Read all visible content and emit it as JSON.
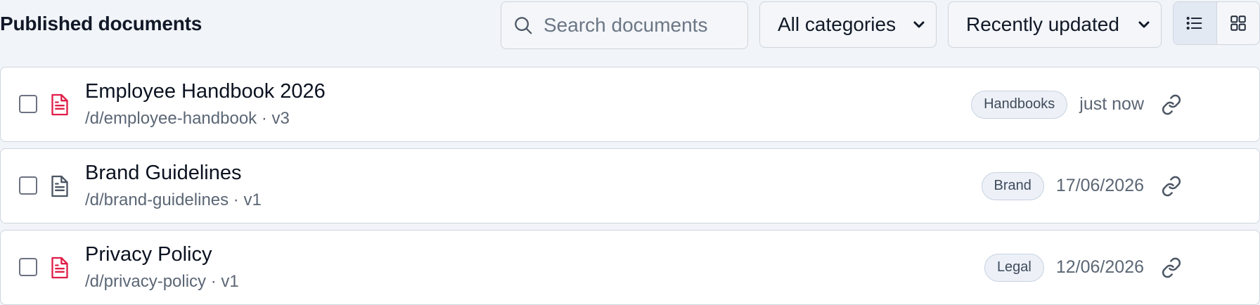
{
  "header": {
    "title": "Published documents",
    "search": {
      "placeholder": "Search documents",
      "value": "",
      "icon": "search-icon"
    },
    "category_filter": {
      "selected": "All categories"
    },
    "sort": {
      "selected": "Recently updated"
    },
    "view_toggle": {
      "active": "list",
      "options": [
        "list",
        "grid"
      ]
    }
  },
  "colors": {
    "accent_pdf": "#e11d48",
    "neutral_doc": "#4b5563",
    "badge_bg": "#edf1f7",
    "background": "#f1f4f8"
  },
  "documents": [
    {
      "title": "Employee Handbook 2026",
      "meta": "/d/employee-handbook · v3",
      "category": "Handbooks",
      "updated": "just now",
      "icon": "pdf-document-icon"
    },
    {
      "title": "Brand Guidelines",
      "meta": "/d/brand-guidelines · v1",
      "category": "Brand",
      "updated": "17/06/2026",
      "icon": "document-icon"
    },
    {
      "title": "Privacy Policy",
      "meta": "/d/privacy-policy · v1",
      "category": "Legal",
      "updated": "12/06/2026",
      "icon": "pdf-document-icon"
    }
  ]
}
